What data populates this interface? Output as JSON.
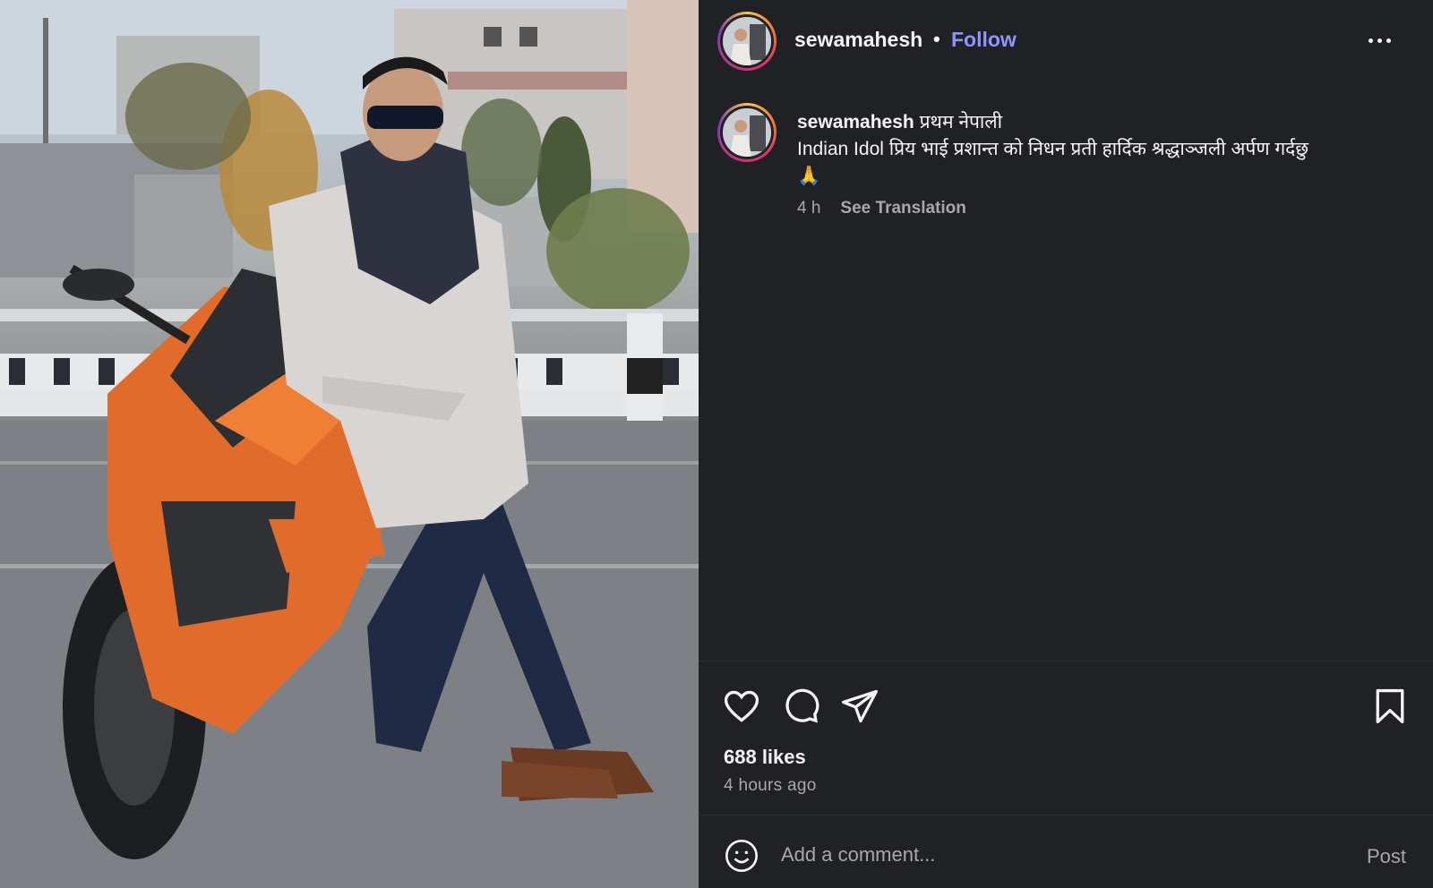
{
  "post": {
    "username": "sewamahesh",
    "separator": "•",
    "follow_label": "Follow",
    "more_icon": "more-horizontal-icon",
    "caption": {
      "username": "sewamahesh",
      "text_line1": "प्रथम नेपाली",
      "text_line2": "Indian Idol प्रिय भाई प्रशान्त को निधन प्रती हार्दिक श्रद्धाञ्जली अर्पण गर्दछु",
      "emoji": "🙏"
    },
    "meta": {
      "age": "4 h",
      "see_translation": "See Translation"
    },
    "actions": {
      "like_icon": "heart-icon",
      "comment_icon": "comment-icon",
      "share_icon": "send-icon",
      "save_icon": "bookmark-icon"
    },
    "likes_label": "688 likes",
    "timestamp": "4 hours ago",
    "comment": {
      "emoji_icon": "smiley-icon",
      "placeholder": "Add a comment...",
      "post_label": "Post"
    }
  },
  "colors": {
    "panel_bg": "#202125",
    "follow_accent": "#8d95ff",
    "muted_text": "#a8a8a8",
    "primary_text": "#f5f5f5"
  }
}
